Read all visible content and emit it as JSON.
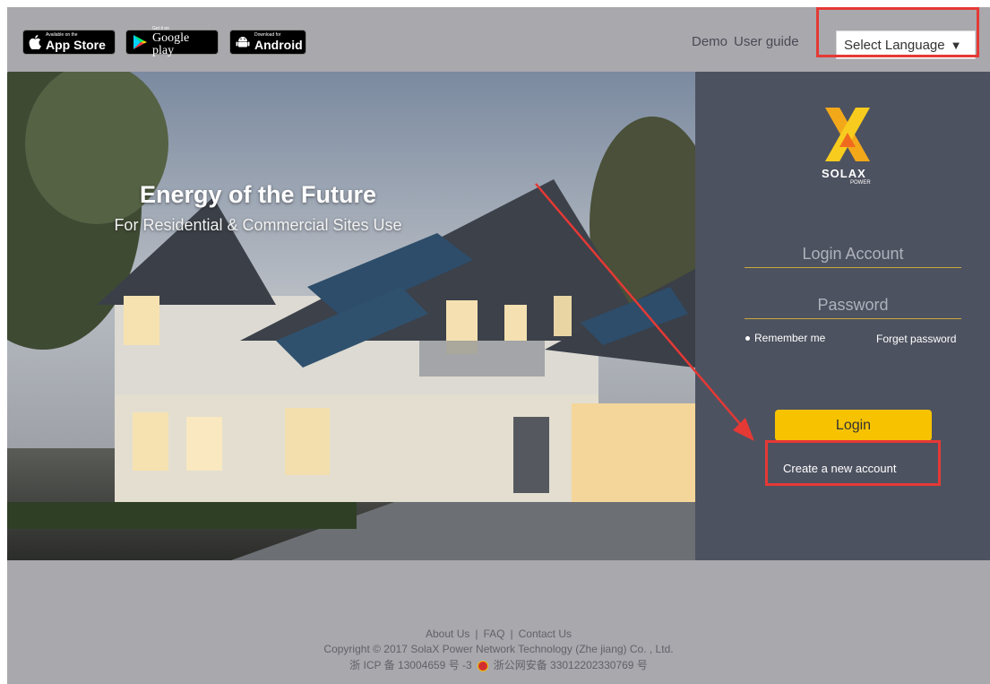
{
  "store_badges": {
    "appstore": {
      "small": "Available on the",
      "big": "App Store"
    },
    "google": {
      "small": "Get it on",
      "big": "Google play"
    },
    "android": {
      "small": "Download for",
      "big": "Android"
    }
  },
  "topnav": {
    "demo": "Demo",
    "user_guide": "User guide",
    "language": "Select Language",
    "language_arrow": "▼"
  },
  "hero": {
    "title": "Energy of the Future",
    "subtitle": "For Residential & Commercial Sites Use"
  },
  "login": {
    "logo_text": "SOLAX",
    "logo_sub": "POWER",
    "account_placeholder": "Login Account",
    "password_placeholder": "Password",
    "remember": "Remember me",
    "forget": "Forget password",
    "login_button": "Login",
    "create_account": "Create a new account"
  },
  "footer": {
    "links": [
      "About Us",
      "FAQ",
      "Contact Us"
    ],
    "copyright": "Copyright © 2017 SolaX Power Network Technology (Zhe jiang) Co. , Ltd.",
    "icp": "浙 ICP 备 13004659 号 -3",
    "security": "浙公网安备 33012202330769 号"
  },
  "colors": {
    "accent": "#f7c300",
    "highlight": "#e53935",
    "panel": "#4d5260",
    "background": "#a9a8ad"
  }
}
